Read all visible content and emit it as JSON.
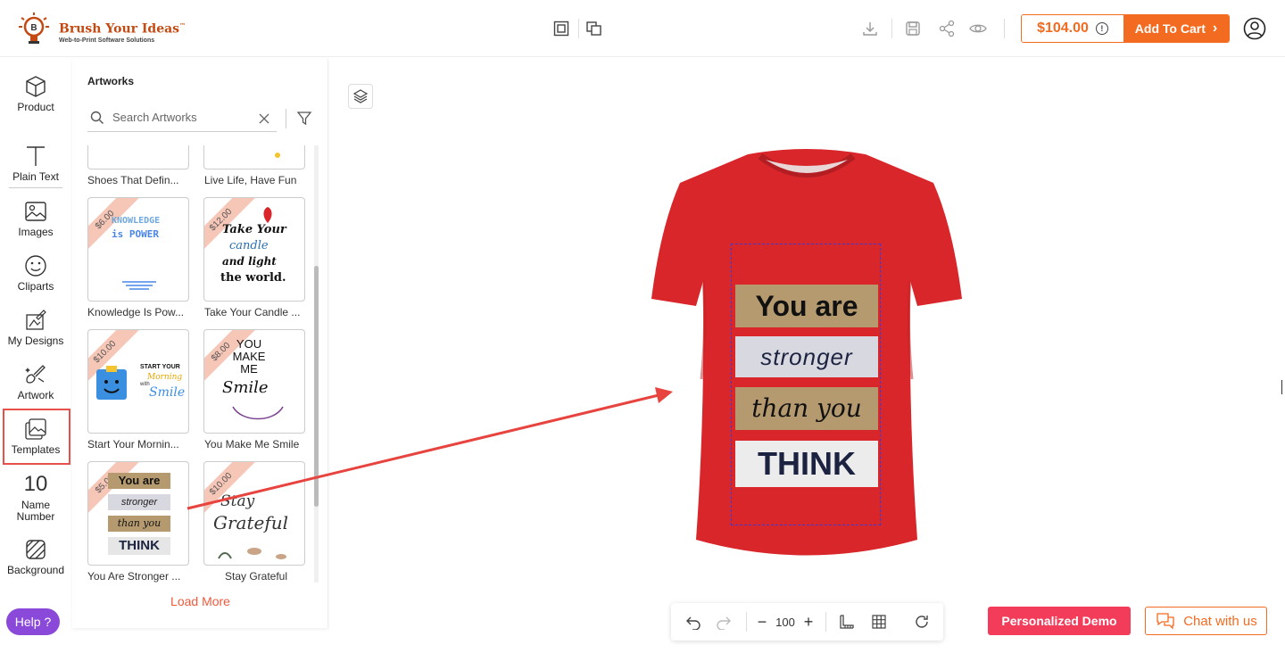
{
  "header": {
    "logo_title": "Brush Your Ideas",
    "logo_tm": "™",
    "logo_subtitle": "Web-to-Print Software Solutions",
    "price": "$104.00",
    "price_info": "!",
    "cart_label": "Add To Cart",
    "cart_chevron": "›"
  },
  "rail": {
    "items": [
      {
        "label": "Product",
        "icon": "cube-icon"
      },
      {
        "label": "Plain Text",
        "icon": "text-icon"
      },
      {
        "label": "Images",
        "icon": "image-icon"
      },
      {
        "label": "Cliparts",
        "icon": "smiley-icon"
      },
      {
        "label": "My Designs",
        "icon": "designs-icon"
      },
      {
        "label": "Artwork",
        "icon": "artwork-icon"
      },
      {
        "label": "Templates",
        "icon": "templates-icon"
      },
      {
        "label": "Name Number",
        "icon": "number-icon",
        "glyph": "10"
      },
      {
        "label": "Background",
        "icon": "background-icon"
      }
    ],
    "active": "Artwork",
    "help_label": "Help ?"
  },
  "panel": {
    "title": "Artworks",
    "search_placeholder": "Search Artworks",
    "load_more": "Load More",
    "cards": [
      {
        "name": "Shoes That Defin...",
        "price": ""
      },
      {
        "name": "Live Life, Have Fun",
        "price": ""
      },
      {
        "name": "Knowledge Is Pow...",
        "price": "$6.00",
        "art": [
          "KNOWLEDGE",
          "is POWER"
        ]
      },
      {
        "name": "Take Your Candle ...",
        "price": "$12.00",
        "art": [
          "Take Your",
          "candle",
          "and light",
          "the world."
        ]
      },
      {
        "name": "Start Your Mornin...",
        "price": "$10.00",
        "art": [
          "START YOUR",
          "Morning",
          "with",
          "Smile"
        ]
      },
      {
        "name": "You Make Me Smile",
        "price": "$8.00",
        "art": [
          "YOU",
          "MAKE",
          "ME",
          "Smile"
        ]
      },
      {
        "name": "You Are Stronger ...",
        "price": "$5.00",
        "art": [
          "You are",
          "stronger",
          "than you",
          "THINK"
        ]
      },
      {
        "name": "Stay Grateful",
        "price": "$10.00",
        "art": [
          "Stay",
          "Grateful"
        ]
      }
    ]
  },
  "canvas": {
    "design_lines": [
      "You are",
      "stronger",
      "than you",
      "THINK"
    ],
    "shirt_color": "#d8262b"
  },
  "toolbar": {
    "zoom": "100",
    "minus": "−",
    "plus": "+"
  },
  "footer": {
    "demo_label": "Personalized Demo",
    "chat_label": "Chat with us"
  },
  "colors": {
    "accent": "#f36b21",
    "help": "#8a49d8",
    "demo": "#f23c5a",
    "active_border": "#e8504c"
  }
}
